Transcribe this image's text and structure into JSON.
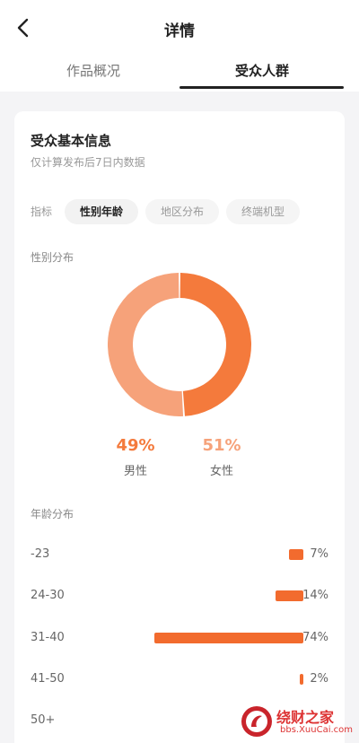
{
  "header": {
    "title": "详情"
  },
  "tabs": [
    {
      "label": "作品概况"
    },
    {
      "label": "受众人群"
    }
  ],
  "section": {
    "title": "受众基本信息",
    "subtitle": "仅计算发布后7日内数据"
  },
  "segment": {
    "label": "指标",
    "options": [
      "性别年龄",
      "地区分布",
      "终端机型"
    ],
    "selected": "性别年龄"
  },
  "gender": {
    "title": "性别分布",
    "male_pct": "49%",
    "male_label": "男性",
    "female_pct": "51%",
    "female_label": "女性",
    "colors": {
      "male": "#f47a3c",
      "female": "#f6a27a"
    }
  },
  "age": {
    "title": "年龄分布",
    "rows": [
      {
        "cat": "-23",
        "val": "7%"
      },
      {
        "cat": "24-30",
        "val": "14%"
      },
      {
        "cat": "31-40",
        "val": "74%"
      },
      {
        "cat": "41-50",
        "val": "2%"
      },
      {
        "cat": "50+",
        "val": ""
      }
    ]
  },
  "chart_data": [
    {
      "type": "pie",
      "title": "性别分布",
      "categories": [
        "男性",
        "女性"
      ],
      "values": [
        49,
        51
      ]
    },
    {
      "type": "bar",
      "title": "年龄分布",
      "categories": [
        "-23",
        "24-30",
        "31-40",
        "41-50",
        "50+"
      ],
      "values": [
        7,
        14,
        74,
        2,
        null
      ]
    }
  ],
  "watermark": {
    "title": "绕财之家",
    "url": "bbs.XuuCai.com"
  }
}
